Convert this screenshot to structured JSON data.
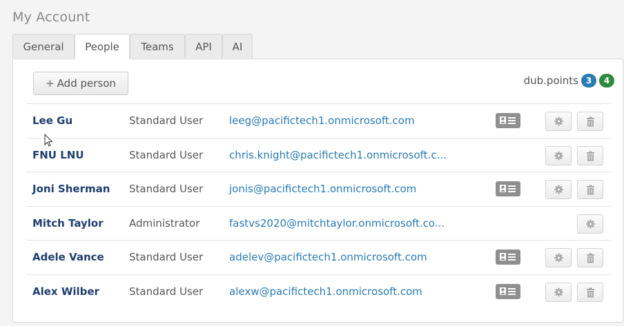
{
  "page": {
    "title": "My Account"
  },
  "tabs": [
    {
      "label": "General",
      "active": false
    },
    {
      "label": "People",
      "active": true
    },
    {
      "label": "Teams",
      "active": false
    },
    {
      "label": "API",
      "active": false
    },
    {
      "label": "AI",
      "active": false
    }
  ],
  "toolbar": {
    "add_person_label": "Add person"
  },
  "points": {
    "label": "dub.points",
    "badge1": "3",
    "badge2": "4",
    "badge1_color": "#2c7bb5",
    "badge2_color": "#2e8b3e"
  },
  "people": [
    {
      "name": "Lee Gu",
      "role": "Standard User",
      "email": "leeg@pacifictech1.onmicrosoft.com",
      "has_contact": true,
      "has_delete": true
    },
    {
      "name": "FNU LNU",
      "role": "Standard User",
      "email": "chris.knight@pacifictech1.onmicrosoft.c...",
      "has_contact": false,
      "has_delete": true
    },
    {
      "name": "Joni Sherman",
      "role": "Standard User",
      "email": "jonis@pacifictech1.onmicrosoft.com",
      "has_contact": true,
      "has_delete": true
    },
    {
      "name": "Mitch Taylor",
      "role": "Administrator",
      "email": "fastvs2020@mitchtaylor.onmicrosoft.co...",
      "has_contact": false,
      "has_delete": false
    },
    {
      "name": "Adele Vance",
      "role": "Standard User",
      "email": "adelev@pacifictech1.onmicrosoft.com",
      "has_contact": true,
      "has_delete": true
    },
    {
      "name": "Alex Wilber",
      "role": "Standard User",
      "email": "alexw@pacifictech1.onmicrosoft.com",
      "has_contact": true,
      "has_delete": true
    }
  ],
  "icons": {
    "add": "plus-icon",
    "contact": "contact-card-icon",
    "settings": "gear-icon",
    "delete": "trash-icon",
    "cursor": "mouse-pointer-icon"
  }
}
